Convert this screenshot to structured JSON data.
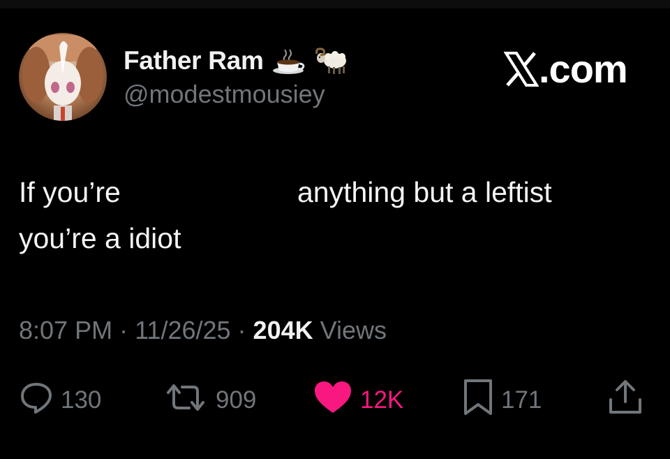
{
  "author": {
    "display_name": "Father Ram",
    "handle": "@modestmousiey",
    "name_emojis": [
      "coffee-cup-icon",
      "ram-icon"
    ]
  },
  "brand": {
    "label": ".com",
    "logo_icon": "x-logo-icon"
  },
  "tweet": {
    "line1_start": "If you’re",
    "line1_end": "anything but a leftist",
    "line2": "you’re a idiot"
  },
  "meta": {
    "time": "8:07 PM",
    "separator": " · ",
    "date": "11/26/25",
    "views_count": "204K",
    "views_label": "Views"
  },
  "actions": {
    "replies": "130",
    "reposts": "909",
    "likes": "12K",
    "bookmarks": "171"
  },
  "colors": {
    "background": "#000000",
    "like_accent": "#f91880",
    "muted_text": "#71767b"
  }
}
